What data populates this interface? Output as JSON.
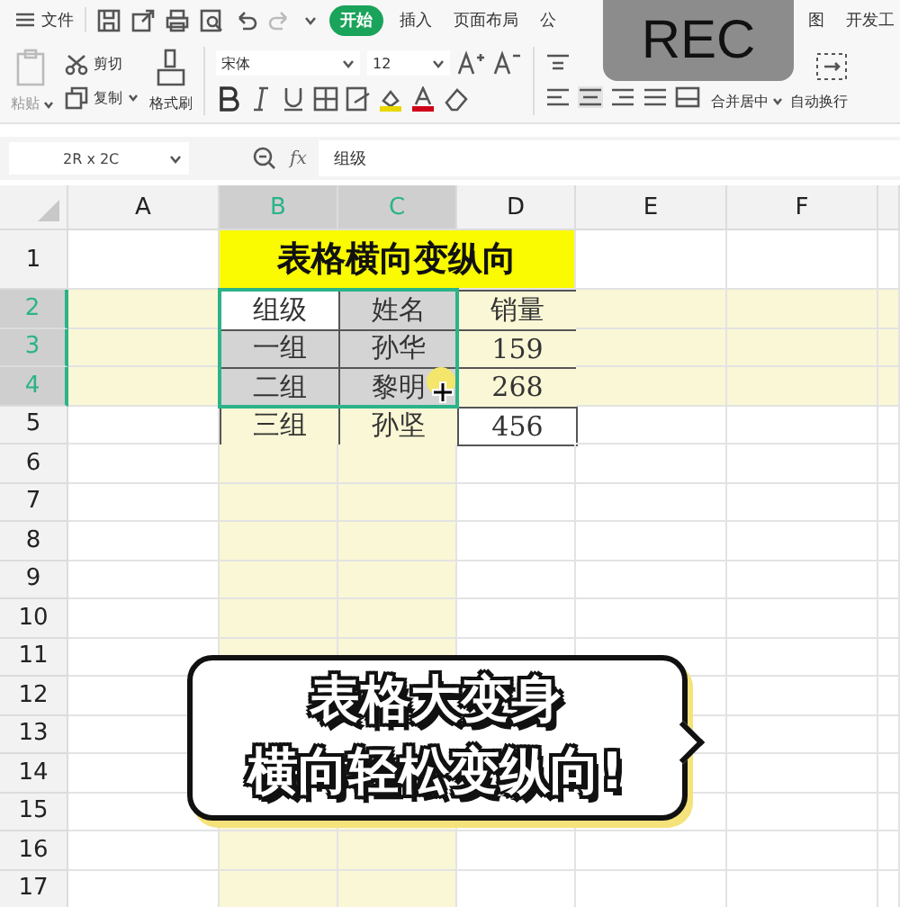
{
  "menu_bar": {
    "file_menu": "文件",
    "tabs": [
      {
        "label": "开始",
        "selected": true
      },
      {
        "label": "插入",
        "selected": false
      },
      {
        "label": "页面布局",
        "selected": false
      },
      {
        "label": "公",
        "selected": false
      },
      {
        "label": "图",
        "selected": false
      },
      {
        "label": "开发工",
        "selected": false
      }
    ]
  },
  "recording_badge": "REC",
  "toolbar": {
    "paste": "粘贴",
    "cut": "剪切",
    "copy": "复制",
    "format_painter": "格式刷",
    "font": "宋体",
    "font_size": "12",
    "merge": "合并居中",
    "wrap": "自动换行"
  },
  "formula_bar": {
    "name_box": "2R x 2C",
    "fx": "fx",
    "value": "组级"
  },
  "sheet": {
    "columns": [
      {
        "label": "A",
        "selected": false
      },
      {
        "label": "B",
        "selected": true
      },
      {
        "label": "C",
        "selected": true
      },
      {
        "label": "D",
        "selected": false
      },
      {
        "label": "E",
        "selected": false
      },
      {
        "label": "F",
        "selected": false
      }
    ],
    "rows": [
      {
        "label": "1",
        "selected": false
      },
      {
        "label": "2",
        "selected": true
      },
      {
        "label": "3",
        "selected": true
      },
      {
        "label": "4",
        "selected": true
      },
      {
        "label": "5",
        "selected": false
      },
      {
        "label": "6",
        "selected": false
      },
      {
        "label": "7",
        "selected": false
      },
      {
        "label": "8",
        "selected": false
      },
      {
        "label": "9",
        "selected": false
      },
      {
        "label": "10",
        "selected": false
      },
      {
        "label": "11",
        "selected": false
      },
      {
        "label": "12",
        "selected": false
      },
      {
        "label": "13",
        "selected": false
      },
      {
        "label": "14",
        "selected": false
      },
      {
        "label": "15",
        "selected": false
      },
      {
        "label": "16",
        "selected": false
      },
      {
        "label": "17",
        "selected": false
      }
    ]
  },
  "table": {
    "title": "表格横向变纵向",
    "rows": [
      [
        {
          "text": "组级",
          "selected": true,
          "active": true
        },
        {
          "text": "姓名",
          "selected": true,
          "active": false
        },
        {
          "text": "销量",
          "selected": false,
          "active": false
        }
      ],
      [
        {
          "text": "一组",
          "selected": true,
          "active": false
        },
        {
          "text": "孙华",
          "selected": true,
          "active": false
        },
        {
          "text": "159",
          "selected": false,
          "active": false
        }
      ],
      [
        {
          "text": "二组",
          "selected": true,
          "active": false
        },
        {
          "text": "黎明",
          "selected": true,
          "active": false
        },
        {
          "text": "268",
          "selected": false,
          "active": false
        }
      ],
      [
        {
          "text": "三组",
          "selected": false,
          "active": false
        },
        {
          "text": "孙坚",
          "selected": false,
          "active": false
        },
        {
          "text": "456",
          "selected": false,
          "active": false
        }
      ]
    ]
  },
  "caption": [
    "表格大变身",
    "横向轻松变纵向!"
  ]
}
